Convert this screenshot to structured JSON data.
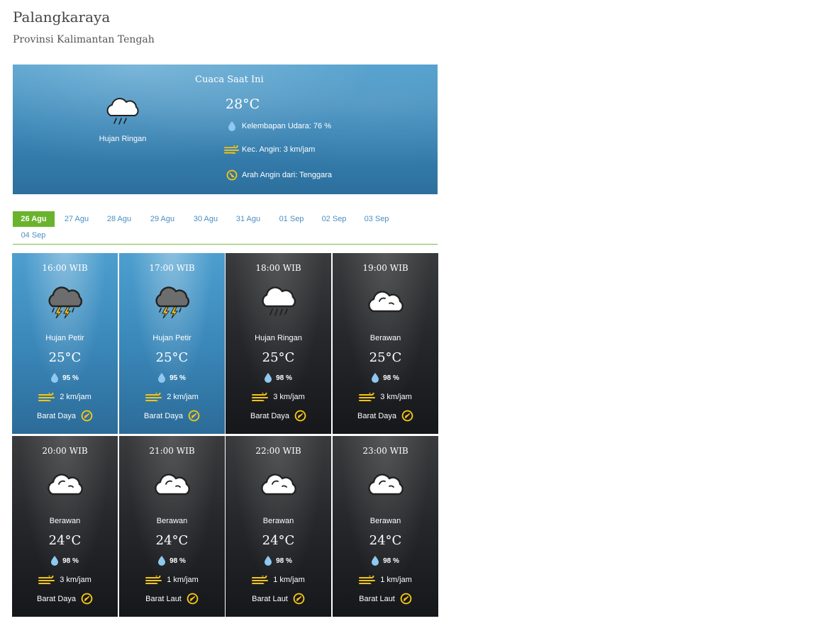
{
  "location": {
    "city": "Palangkaraya",
    "province": "Provinsi Kalimantan Tengah"
  },
  "current": {
    "label": "Cuaca Saat Ini",
    "icon": "cloud-rain-icon",
    "condition": "Hujan Ringan",
    "temperature": "28°C",
    "humidity": "Kelembapan Udara: 76 %",
    "wind_speed": "Kec. Angin: 3 km/jam",
    "wind_direction": "Arah Angin dari: Tenggara"
  },
  "tabs": [
    "26 Agu",
    "27 Agu",
    "28 Agu",
    "29 Agu",
    "30 Agu",
    "31 Agu",
    "01 Sep",
    "02 Sep",
    "03 Sep",
    "04 Sep"
  ],
  "active_tab": "26 Agu",
  "colors": {
    "active_tab": "#6ab32c",
    "tab_text": "#4a8fc4",
    "wind_icon": "#f5c518",
    "drop_icon": "#8fc8f0"
  },
  "forecast": [
    {
      "time": "16:00 WIB",
      "condition": "Hujan Petir",
      "temp": "25°C",
      "humidity": "95 %",
      "wind": "2 km/jam",
      "direction": "Barat Daya",
      "icon": "thunderstorm-icon",
      "theme": "day"
    },
    {
      "time": "17:00 WIB",
      "condition": "Hujan Petir",
      "temp": "25°C",
      "humidity": "95 %",
      "wind": "2 km/jam",
      "direction": "Barat Daya",
      "icon": "thunderstorm-icon",
      "theme": "day"
    },
    {
      "time": "18:00 WIB",
      "condition": "Hujan Ringan",
      "temp": "25°C",
      "humidity": "98 %",
      "wind": "3 km/jam",
      "direction": "Barat Daya",
      "icon": "cloud-rain-icon",
      "theme": "night"
    },
    {
      "time": "19:00 WIB",
      "condition": "Berawan",
      "temp": "25°C",
      "humidity": "98 %",
      "wind": "3 km/jam",
      "direction": "Barat Daya",
      "icon": "cloud-icon",
      "theme": "night"
    },
    {
      "time": "20:00 WIB",
      "condition": "Berawan",
      "temp": "24°C",
      "humidity": "98 %",
      "wind": "3 km/jam",
      "direction": "Barat Daya",
      "icon": "cloud-icon",
      "theme": "night"
    },
    {
      "time": "21:00 WIB",
      "condition": "Berawan",
      "temp": "24°C",
      "humidity": "98 %",
      "wind": "1 km/jam",
      "direction": "Barat Laut",
      "icon": "cloud-icon",
      "theme": "night"
    },
    {
      "time": "22:00 WIB",
      "condition": "Berawan",
      "temp": "24°C",
      "humidity": "98 %",
      "wind": "1 km/jam",
      "direction": "Barat Laut",
      "icon": "cloud-icon",
      "theme": "night"
    },
    {
      "time": "23:00 WIB",
      "condition": "Berawan",
      "temp": "24°C",
      "humidity": "98 %",
      "wind": "1 km/jam",
      "direction": "Barat Laut",
      "icon": "cloud-icon",
      "theme": "night"
    }
  ]
}
